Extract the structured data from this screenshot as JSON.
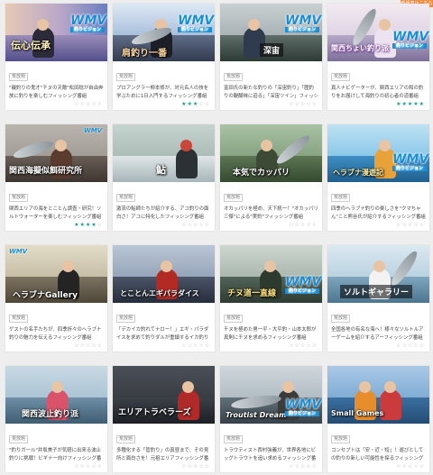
{
  "top_button": {
    "label": "番組表はこちら"
  },
  "programs": [
    {
      "title": "伝心伝承",
      "tag": "荒放題",
      "desc": "\"磯釣りの鬼才\"チヌの天敵\"松田稔が自由奔放に釣りを楽しむフィッシング番組",
      "stars": 0
    },
    {
      "title": "肩釣り一番",
      "tag": "荒放題",
      "desc": "プロアングラー柳本修が、対元名人の技を学ぶために1日入門するフィッシング番組",
      "stars": 3
    },
    {
      "title": "深宙",
      "tag": "荒放題",
      "desc": "富田氏の新たな釣りの「深宙釣り」「歴釣りの醍醐味に迫る」「深宙ツイン」フィッシング番組",
      "stars": 0
    },
    {
      "title": "関西ちょい釣り派",
      "tag": "荒放題",
      "desc": "真人ナビゲーターが、関西エリアの和の釣りをお届けして海釣りの初心者の道番組",
      "stars": 5
    },
    {
      "title": "関西海擬似餌研究所",
      "tag": "荒放題",
      "desc": "関西エリアの海をとことん調査・研究！ソルトウォーターを楽しむフィッシング番組",
      "stars": 4
    },
    {
      "title": "鮎",
      "tag": "荒放題",
      "desc": "激流の鮎師たちが紹介する、アユ釣りの面白さ！アユに特化したフィッシング番組",
      "stars": 0
    },
    {
      "title": "本気でカッパリ",
      "tag": "荒放題",
      "desc": "オカッパリを極め、天下統一！\"オカッパリ三傑\"による\"実釣\"フィッシング番組",
      "stars": 0
    },
    {
      "title": "ヘラブナ漫遊記",
      "tag": "荒放題",
      "desc": "四季のヘラブナ釣りの楽しさを\"クマちゃん\"こと熊谷氏が紹介するフィッシング番組",
      "stars": 0
    },
    {
      "title": "ヘラブナGallery",
      "tag": "荒放題",
      "desc": "ゲストの名手たちが、四季折々のヘラブナ釣りの魅力を伝えるフィッシング番組",
      "stars": 0
    },
    {
      "title": "とことんエギパラダイス",
      "tag": "荒放題",
      "desc": "「デカイカ釣れてナロー！」エギ・パラダイスを求めて釣りダルが重鎮するイカ釣り番組",
      "stars": 0
    },
    {
      "title": "チヌ道一直線",
      "tag": "荒放題",
      "desc": "チヌを極めた男一平・大平釣・山本太郎が真剣にチヌを求めるフィッシング番組",
      "stars": 0
    },
    {
      "title": "ソルトギャラリー",
      "tag": "荒放題",
      "desc": "全国各地の有名な海へ！様々なソルトルアーゲームを紹介するアーフィッシング番組",
      "stars": 0
    },
    {
      "title": "関西波止釣り派",
      "tag": "荒放題",
      "desc": "\"釣りガール\"井坂美子が気軽に出来る波止釣りに挑戦！ビギナー向けフィッシング番組",
      "stars": 0
    },
    {
      "title": "エリアトラベラーズ",
      "tag": "荒放題",
      "desc": "多種化する「管釣り」の真昼まで、その見所と面白さを！元祖エリアフィッシング番組",
      "stars": 0
    },
    {
      "title": "Troutist Dream",
      "tag": "荒放題",
      "desc": "トラウティスト西村強義が、世界各地にビッグトラウトを追い求めるフィッシング番組",
      "stars": 0
    },
    {
      "title": "Small Games",
      "tag": "荒放題",
      "desc": "コンセプトは「安・近・短」！遊びとしての釣りの新しい可能性を探るフィッシング番組",
      "stars": 0
    }
  ],
  "logo": {
    "text": "WMV",
    "sub": "釣りビジョン"
  }
}
